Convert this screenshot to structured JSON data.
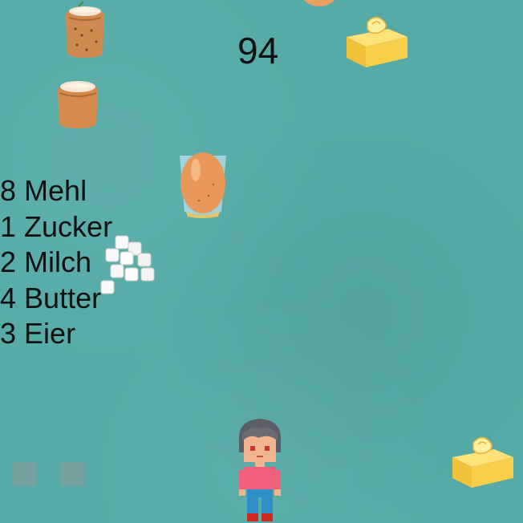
{
  "hud": {
    "score": "94"
  },
  "inventory": [
    {
      "count": "8",
      "name": "Mehl"
    },
    {
      "count": "1",
      "name": "Zucker"
    },
    {
      "count": "2",
      "name": "Milch"
    },
    {
      "count": "4",
      "name": "Butter"
    },
    {
      "count": "3",
      "name": "Eier"
    }
  ],
  "colors": {
    "background": "#56aba6",
    "text": "#111111",
    "button": "#7a9f9d"
  }
}
